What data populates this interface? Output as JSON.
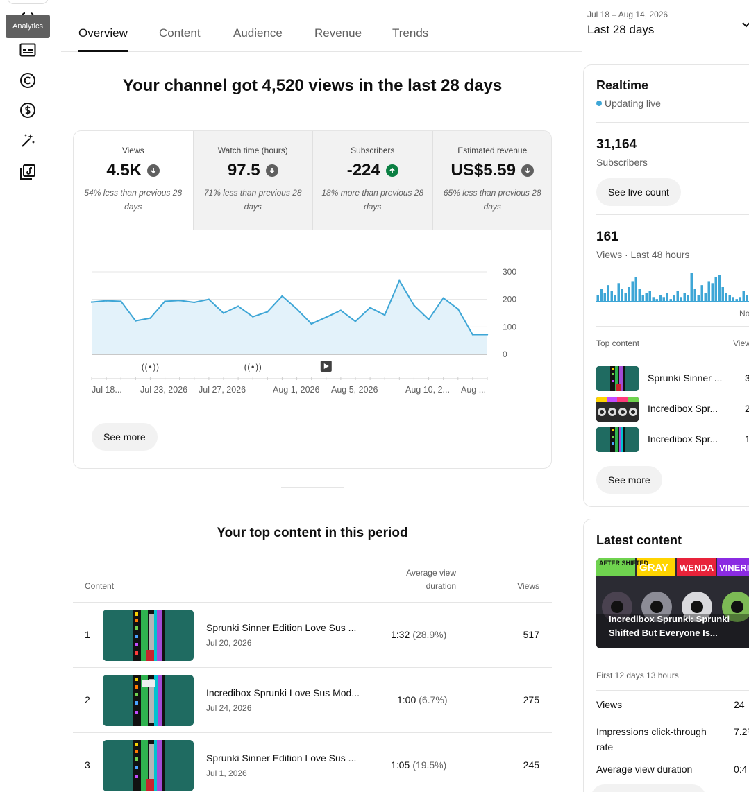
{
  "rail": {
    "tooltip": "Analytics",
    "icons": [
      "analytics-icon",
      "subtitles-icon",
      "copyright-icon",
      "monetization-icon",
      "customization-icon",
      "audio-library-icon"
    ]
  },
  "tabs": [
    "Overview",
    "Content",
    "Audience",
    "Revenue",
    "Trends"
  ],
  "date_picker": {
    "range": "Jul 18 – Aug 14, 2026",
    "label": "Last 28 days"
  },
  "headline": "Your channel got 4,520 views in the last 28 days",
  "metrics": [
    {
      "label": "Views",
      "value": "4.5K",
      "trend": "down",
      "note": "54% less than previous 28 days"
    },
    {
      "label": "Watch time (hours)",
      "value": "97.5",
      "trend": "down",
      "note": "71% less than previous 28 days"
    },
    {
      "label": "Subscribers",
      "value": "-224",
      "trend": "up",
      "note": "18% more than previous 28 days"
    },
    {
      "label": "Estimated revenue",
      "value": "US$5.59",
      "trend": "down",
      "note": "65% less than previous 28 days"
    }
  ],
  "chart_data": {
    "type": "area",
    "x": [
      1,
      2,
      3,
      4,
      5,
      6,
      7,
      8,
      9,
      10,
      11,
      12,
      13,
      14,
      15,
      16,
      17,
      18,
      19,
      20,
      21,
      22,
      23,
      24,
      25,
      26,
      27,
      28
    ],
    "values": [
      190,
      195,
      193,
      122,
      132,
      193,
      196,
      189,
      200,
      150,
      175,
      137,
      155,
      212,
      165,
      111,
      135,
      160,
      120,
      170,
      143,
      268,
      178,
      127,
      205,
      165,
      72,
      72
    ],
    "yticks": [
      "300",
      "200",
      "100",
      "0"
    ],
    "ylim": [
      0,
      300
    ],
    "xlabels": [
      "Jul 18...",
      "Jul 23, 2026",
      "Jul 27, 2026",
      "Aug 1, 2026",
      "Aug 5, 2026",
      "Aug 10, 2...",
      "Aug ..."
    ],
    "markers": [
      "live-icon",
      "live-icon",
      "video-icon"
    ]
  },
  "card": {
    "see_more": "See more"
  },
  "top_content": {
    "title": "Your top content in this period",
    "headers": {
      "content": "Content",
      "avd": "Average view duration",
      "views": "Views"
    },
    "rows": [
      {
        "rank": "1",
        "title": "Sprunki Sinner Edition Love Sus ...",
        "date": "Jul 20, 2026",
        "avd": "1:32",
        "pct": "(28.9%)",
        "views": "517"
      },
      {
        "rank": "2",
        "title": "Incredibox Sprunki Love Sus Mod...",
        "date": "Jul 24, 2026",
        "avd": "1:00",
        "pct": "(6.7%)",
        "views": "275"
      },
      {
        "rank": "3",
        "title": "Sprunki Sinner Edition Love Sus ...",
        "date": "Jul 1, 2026",
        "avd": "1:05",
        "pct": "(19.5%)",
        "views": "245"
      }
    ]
  },
  "realtime": {
    "title": "Realtime",
    "status": "Updating live",
    "subs_value": "31,164",
    "subs_label": "Subscribers",
    "live_count": "See live count",
    "views_value": "161",
    "views_label": "Views · Last 48 hours",
    "bars": [
      3,
      6,
      4,
      8,
      5,
      3,
      9,
      6,
      4,
      7,
      10,
      12,
      6,
      3,
      4,
      5,
      2,
      1,
      3,
      2,
      4,
      1,
      3,
      5,
      2,
      4,
      3,
      14,
      6,
      3,
      8,
      4,
      10,
      9,
      12,
      13,
      7,
      4,
      3,
      2,
      1,
      2,
      5,
      3,
      8,
      4,
      2,
      6
    ],
    "now_label": "No",
    "tc_header": "Top content",
    "tc_views_header": "View",
    "items": [
      {
        "title": "Sprunki Sinner ...",
        "views": "3"
      },
      {
        "title": "Incredibox Spr...",
        "views": "2"
      },
      {
        "title": "Incredibox Spr...",
        "views": "1"
      }
    ],
    "see_more": "See more"
  },
  "latest": {
    "title": "Latest content",
    "labels": [
      "AFTER SHIFTED",
      "GRAY",
      "WENDA",
      "VINERI"
    ],
    "caption": "Incredibox Sprunki: Sprunki Shifted But Everyone Is...",
    "period": "First 12 days 13 hours",
    "stats": [
      {
        "label": "Views",
        "value": "24"
      },
      {
        "label": "Impressions click-through rate",
        "value": "7.2%"
      },
      {
        "label": "Average view duration",
        "value": "0:4"
      }
    ]
  }
}
